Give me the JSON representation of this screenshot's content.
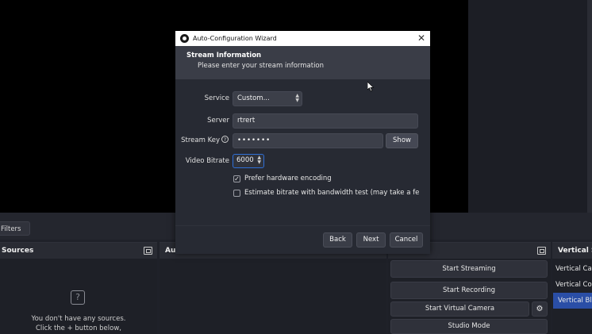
{
  "background": {
    "filters_label": "Filters",
    "sources": {
      "title": "Sources",
      "empty_line1": "You don't have any sources.",
      "empty_line2": "Click the + button below,"
    },
    "audio": {
      "title": "Au"
    },
    "controls": {
      "start_streaming": "Start Streaming",
      "start_recording": "Start Recording",
      "start_virtual_camera": "Start Virtual Camera",
      "studio_mode": "Studio Mode"
    },
    "vertical": {
      "title": "Vertical Sc",
      "items": [
        "Vertical Cam",
        "Vertical Con",
        "Vertical Blar"
      ]
    }
  },
  "dialog": {
    "title": "Auto-Configuration Wizard",
    "close": "✕",
    "header_title": "Stream Information",
    "header_subtitle": "Please enter your stream information",
    "service": {
      "label": "Service",
      "value": "Custom..."
    },
    "server": {
      "label": "Server",
      "value": "rtrert"
    },
    "stream_key": {
      "label": "Stream Key",
      "value": "•••••••",
      "show_label": "Show"
    },
    "video_bitrate": {
      "label": "Video Bitrate",
      "value": "6000"
    },
    "prefer_hw": {
      "label": "Prefer hardware encoding",
      "checked": true
    },
    "estimate_bitrate": {
      "label": "Estimate bitrate with bandwidth test (may take a few minut",
      "checked": false
    },
    "buttons": {
      "back": "Back",
      "next": "Next",
      "cancel": "Cancel"
    }
  },
  "colors": {
    "accent": "#2f6fd6",
    "selected_item": "#2a4ea6"
  }
}
